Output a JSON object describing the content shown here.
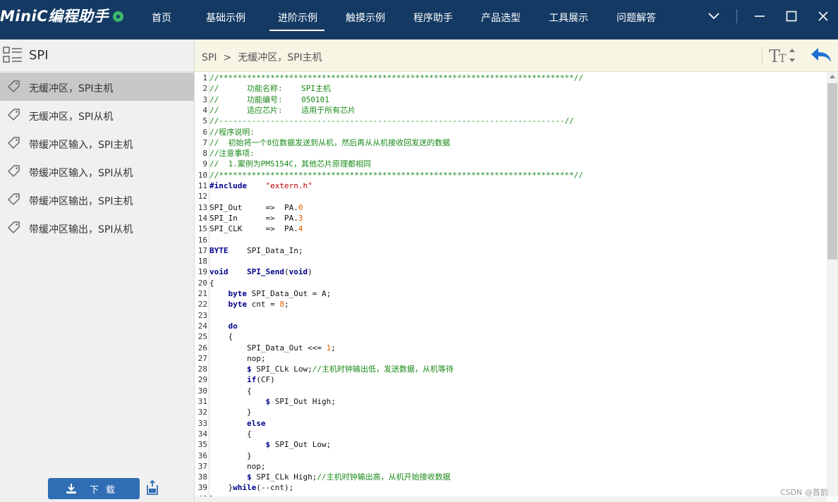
{
  "app": {
    "title": "MiniC编程助手"
  },
  "nav": {
    "items": [
      "首页",
      "基础示例",
      "进阶示例",
      "触摸示例",
      "程序助手",
      "产品选型",
      "工具展示",
      "问题解答"
    ],
    "active_index": 2
  },
  "sidebar": {
    "title": "SPI",
    "items": [
      {
        "label": "无缓冲区，SPI主机",
        "active": true
      },
      {
        "label": "无缓冲区，SPI从机",
        "active": false
      },
      {
        "label": "带缓冲区输入，SPI主机",
        "active": false
      },
      {
        "label": "带缓冲区输入，SPI从机",
        "active": false
      },
      {
        "label": "带缓冲区输出，SPI主机",
        "active": false
      },
      {
        "label": "带缓冲区输出，SPI从机",
        "active": false
      }
    ],
    "download_label": "下载"
  },
  "breadcrumb": {
    "section": "SPI",
    "separator": ">",
    "page": "无缓冲区，SPI主机"
  },
  "code": {
    "lines": [
      [
        [
          "c",
          "//****************************************************************************//"
        ]
      ],
      [
        [
          "c",
          "//      功能名称:    SPI主机"
        ]
      ],
      [
        [
          "c",
          "//      功能编号:    050101"
        ]
      ],
      [
        [
          "c",
          "//      适应芯片:    适用于所有芯片"
        ]
      ],
      [
        [
          "c",
          "//--------------------------------------------------------------------------//"
        ]
      ],
      [
        [
          "c",
          "//程序说明:"
        ]
      ],
      [
        [
          "c",
          "//  初始将一个8位数据发送到从机，然后再从从机接收回发送的数据"
        ]
      ],
      [
        [
          "c",
          "//注意事项:"
        ]
      ],
      [
        [
          "c",
          "//  1.案例为PMS154C，其他芯片原理都相同"
        ]
      ],
      [
        [
          "c",
          "//****************************************************************************//"
        ]
      ],
      [
        [
          "k",
          "#include"
        ],
        [
          "t",
          "    "
        ],
        [
          "s",
          "\"extern.h\""
        ]
      ],
      [],
      [
        [
          "t",
          "SPI_Out     =>  PA."
        ],
        [
          "n",
          "0"
        ]
      ],
      [
        [
          "t",
          "SPI_In      =>  PA."
        ],
        [
          "n",
          "3"
        ]
      ],
      [
        [
          "t",
          "SPI_CLK     =>  PA."
        ],
        [
          "n",
          "4"
        ]
      ],
      [],
      [
        [
          "k",
          "BYTE"
        ],
        [
          "t",
          "    SPI_Data_In;"
        ]
      ],
      [],
      [
        [
          "k",
          "void"
        ],
        [
          "t",
          "    "
        ],
        [
          "kw2",
          "SPI_Send"
        ],
        [
          "t",
          "("
        ],
        [
          "k",
          "void"
        ],
        [
          "t",
          ")"
        ]
      ],
      [
        [
          "t",
          "{"
        ]
      ],
      [
        [
          "t",
          "    "
        ],
        [
          "k",
          "byte"
        ],
        [
          "t",
          " SPI_Data_Out = A;"
        ]
      ],
      [
        [
          "t",
          "    "
        ],
        [
          "k",
          "byte"
        ],
        [
          "t",
          " cnt = "
        ],
        [
          "n",
          "8"
        ],
        [
          "t",
          ";"
        ]
      ],
      [],
      [
        [
          "t",
          "    "
        ],
        [
          "k",
          "do"
        ]
      ],
      [
        [
          "t",
          "    {"
        ]
      ],
      [
        [
          "t",
          "        SPI_Data_Out <<= "
        ],
        [
          "n",
          "1"
        ],
        [
          "t",
          ";"
        ]
      ],
      [
        [
          "t",
          "        nop;"
        ]
      ],
      [
        [
          "t",
          "        "
        ],
        [
          "k",
          "$"
        ],
        [
          "t",
          " SPI_CLk Low;"
        ],
        [
          "c",
          "//主机时钟输出低，发送数据，从机等待"
        ]
      ],
      [
        [
          "t",
          "        "
        ],
        [
          "k",
          "if"
        ],
        [
          "t",
          "(CF)"
        ]
      ],
      [
        [
          "t",
          "        {"
        ]
      ],
      [
        [
          "t",
          "            "
        ],
        [
          "k",
          "$"
        ],
        [
          "t",
          " SPI_Out High;"
        ]
      ],
      [
        [
          "t",
          "        }"
        ]
      ],
      [
        [
          "t",
          "        "
        ],
        [
          "k",
          "else"
        ]
      ],
      [
        [
          "t",
          "        {"
        ]
      ],
      [
        [
          "t",
          "            "
        ],
        [
          "k",
          "$"
        ],
        [
          "t",
          " SPI_Out Low;"
        ]
      ],
      [
        [
          "t",
          "        }"
        ]
      ],
      [
        [
          "t",
          "        nop;"
        ]
      ],
      [
        [
          "t",
          "        "
        ],
        [
          "k",
          "$"
        ],
        [
          "t",
          " SPI_CLk High;"
        ],
        [
          "c",
          "//主机时钟输出高，从机开始接收数据"
        ]
      ],
      [
        [
          "t",
          "    }"
        ],
        [
          "k",
          "while"
        ],
        [
          "t",
          "(--cnt);"
        ]
      ],
      [
        [
          "t",
          "}"
        ]
      ]
    ]
  },
  "watermark": "CSDN @首韵",
  "colors": {
    "titlebar": "#143a64",
    "sidebar_active": "#c8c8c8",
    "header_bg": "#f7f5e4",
    "download_button": "#2f6db4",
    "back_arrow": "#1d6fd6"
  }
}
